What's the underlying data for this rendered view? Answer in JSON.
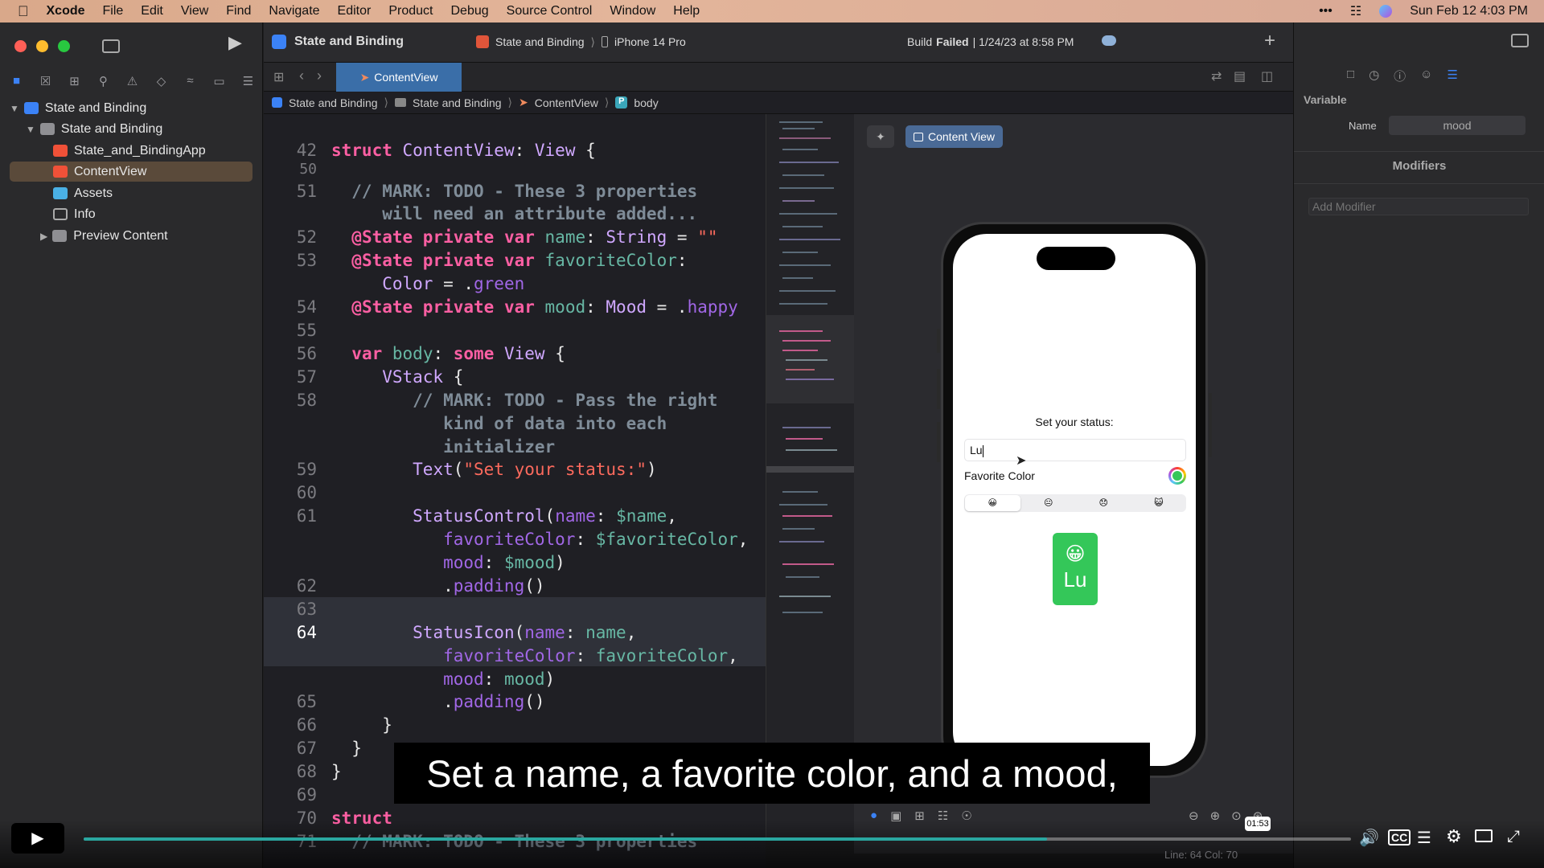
{
  "menubar": {
    "app": "Xcode",
    "items": [
      "File",
      "Edit",
      "View",
      "Find",
      "Navigate",
      "Editor",
      "Product",
      "Debug",
      "Source Control",
      "Window",
      "Help"
    ],
    "datetime": "Sun Feb 12  4:03 PM"
  },
  "toolbar": {
    "project": "State and Binding",
    "scheme": "State and Binding",
    "device": "iPhone 14 Pro",
    "status_bold": "Failed",
    "status_prefix": "Build",
    "status_suffix": "| 1/24/23 at 8:58 PM"
  },
  "tabs": {
    "active": "ContentView"
  },
  "jumpbar": [
    "State and Binding",
    "State and Binding",
    "ContentView",
    "body"
  ],
  "navigator": {
    "items": [
      {
        "label": "State and Binding"
      },
      {
        "label": "State and Binding"
      },
      {
        "label": "State_and_BindingApp"
      },
      {
        "label": "ContentView"
      },
      {
        "label": "Assets"
      },
      {
        "label": "Info"
      },
      {
        "label": "Preview Content"
      }
    ]
  },
  "code": {
    "line_numbers": [
      "42",
      "50",
      "51",
      "",
      "52",
      "53",
      "",
      "54",
      "55",
      "56",
      "57",
      "58",
      "",
      "",
      "59",
      "60",
      "61",
      "",
      "",
      "62",
      "63",
      "64",
      "",
      "",
      "65",
      "66",
      "67",
      "68",
      "69",
      "70",
      "71"
    ],
    "current_line": "64"
  },
  "preview": {
    "pin_label": "Content View",
    "status_label": "Set your status:",
    "name_value": "Lu",
    "favorite_color_label": "Favorite Color",
    "mood_segments": [
      "😀",
      "😐",
      "😞",
      "😺"
    ],
    "icon_emoji": "😀",
    "icon_name": "Lu",
    "accent": "#34c759"
  },
  "inspector": {
    "section": "Variable",
    "name_label": "Name",
    "name_value": "mood",
    "modifiers_title": "Modifiers",
    "add_modifier_placeholder": "Add Modifier"
  },
  "subtitle": "Set a name, a favorite color, and a mood,",
  "player": {
    "time": "01:53",
    "progress": 0.76,
    "progress_color": "#2aa7a0",
    "status_line": "Line: 64  Col: 70"
  }
}
